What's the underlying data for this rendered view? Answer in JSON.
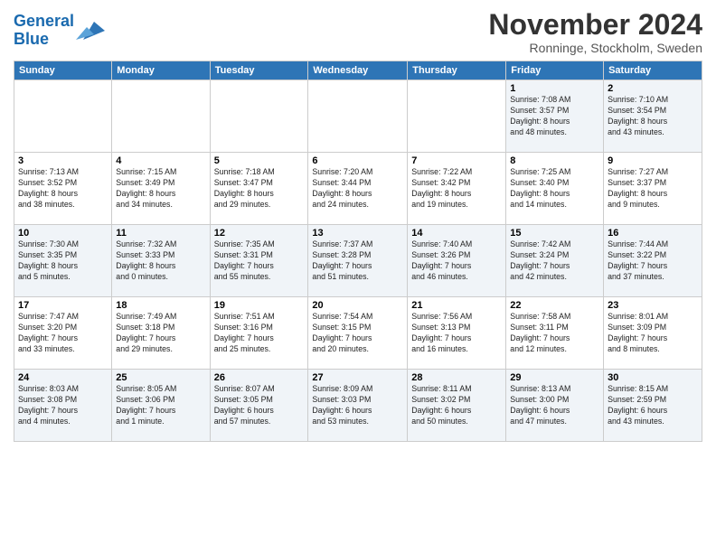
{
  "logo": {
    "line1": "General",
    "line2": "Blue"
  },
  "title": "November 2024",
  "location": "Ronninge, Stockholm, Sweden",
  "weekdays": [
    "Sunday",
    "Monday",
    "Tuesday",
    "Wednesday",
    "Thursday",
    "Friday",
    "Saturday"
  ],
  "weeks": [
    [
      {
        "day": "",
        "info": ""
      },
      {
        "day": "",
        "info": ""
      },
      {
        "day": "",
        "info": ""
      },
      {
        "day": "",
        "info": ""
      },
      {
        "day": "",
        "info": ""
      },
      {
        "day": "1",
        "info": "Sunrise: 7:08 AM\nSunset: 3:57 PM\nDaylight: 8 hours\nand 48 minutes."
      },
      {
        "day": "2",
        "info": "Sunrise: 7:10 AM\nSunset: 3:54 PM\nDaylight: 8 hours\nand 43 minutes."
      }
    ],
    [
      {
        "day": "3",
        "info": "Sunrise: 7:13 AM\nSunset: 3:52 PM\nDaylight: 8 hours\nand 38 minutes."
      },
      {
        "day": "4",
        "info": "Sunrise: 7:15 AM\nSunset: 3:49 PM\nDaylight: 8 hours\nand 34 minutes."
      },
      {
        "day": "5",
        "info": "Sunrise: 7:18 AM\nSunset: 3:47 PM\nDaylight: 8 hours\nand 29 minutes."
      },
      {
        "day": "6",
        "info": "Sunrise: 7:20 AM\nSunset: 3:44 PM\nDaylight: 8 hours\nand 24 minutes."
      },
      {
        "day": "7",
        "info": "Sunrise: 7:22 AM\nSunset: 3:42 PM\nDaylight: 8 hours\nand 19 minutes."
      },
      {
        "day": "8",
        "info": "Sunrise: 7:25 AM\nSunset: 3:40 PM\nDaylight: 8 hours\nand 14 minutes."
      },
      {
        "day": "9",
        "info": "Sunrise: 7:27 AM\nSunset: 3:37 PM\nDaylight: 8 hours\nand 9 minutes."
      }
    ],
    [
      {
        "day": "10",
        "info": "Sunrise: 7:30 AM\nSunset: 3:35 PM\nDaylight: 8 hours\nand 5 minutes."
      },
      {
        "day": "11",
        "info": "Sunrise: 7:32 AM\nSunset: 3:33 PM\nDaylight: 8 hours\nand 0 minutes."
      },
      {
        "day": "12",
        "info": "Sunrise: 7:35 AM\nSunset: 3:31 PM\nDaylight: 7 hours\nand 55 minutes."
      },
      {
        "day": "13",
        "info": "Sunrise: 7:37 AM\nSunset: 3:28 PM\nDaylight: 7 hours\nand 51 minutes."
      },
      {
        "day": "14",
        "info": "Sunrise: 7:40 AM\nSunset: 3:26 PM\nDaylight: 7 hours\nand 46 minutes."
      },
      {
        "day": "15",
        "info": "Sunrise: 7:42 AM\nSunset: 3:24 PM\nDaylight: 7 hours\nand 42 minutes."
      },
      {
        "day": "16",
        "info": "Sunrise: 7:44 AM\nSunset: 3:22 PM\nDaylight: 7 hours\nand 37 minutes."
      }
    ],
    [
      {
        "day": "17",
        "info": "Sunrise: 7:47 AM\nSunset: 3:20 PM\nDaylight: 7 hours\nand 33 minutes."
      },
      {
        "day": "18",
        "info": "Sunrise: 7:49 AM\nSunset: 3:18 PM\nDaylight: 7 hours\nand 29 minutes."
      },
      {
        "day": "19",
        "info": "Sunrise: 7:51 AM\nSunset: 3:16 PM\nDaylight: 7 hours\nand 25 minutes."
      },
      {
        "day": "20",
        "info": "Sunrise: 7:54 AM\nSunset: 3:15 PM\nDaylight: 7 hours\nand 20 minutes."
      },
      {
        "day": "21",
        "info": "Sunrise: 7:56 AM\nSunset: 3:13 PM\nDaylight: 7 hours\nand 16 minutes."
      },
      {
        "day": "22",
        "info": "Sunrise: 7:58 AM\nSunset: 3:11 PM\nDaylight: 7 hours\nand 12 minutes."
      },
      {
        "day": "23",
        "info": "Sunrise: 8:01 AM\nSunset: 3:09 PM\nDaylight: 7 hours\nand 8 minutes."
      }
    ],
    [
      {
        "day": "24",
        "info": "Sunrise: 8:03 AM\nSunset: 3:08 PM\nDaylight: 7 hours\nand 4 minutes."
      },
      {
        "day": "25",
        "info": "Sunrise: 8:05 AM\nSunset: 3:06 PM\nDaylight: 7 hours\nand 1 minute."
      },
      {
        "day": "26",
        "info": "Sunrise: 8:07 AM\nSunset: 3:05 PM\nDaylight: 6 hours\nand 57 minutes."
      },
      {
        "day": "27",
        "info": "Sunrise: 8:09 AM\nSunset: 3:03 PM\nDaylight: 6 hours\nand 53 minutes."
      },
      {
        "day": "28",
        "info": "Sunrise: 8:11 AM\nSunset: 3:02 PM\nDaylight: 6 hours\nand 50 minutes."
      },
      {
        "day": "29",
        "info": "Sunrise: 8:13 AM\nSunset: 3:00 PM\nDaylight: 6 hours\nand 47 minutes."
      },
      {
        "day": "30",
        "info": "Sunrise: 8:15 AM\nSunset: 2:59 PM\nDaylight: 6 hours\nand 43 minutes."
      }
    ]
  ]
}
